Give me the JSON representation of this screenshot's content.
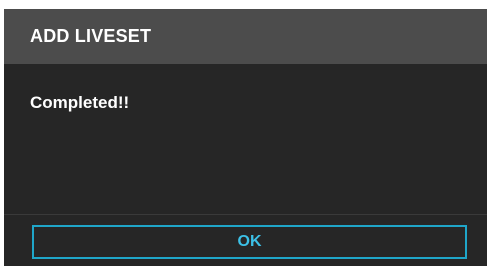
{
  "dialog": {
    "title": "ADD LIVESET",
    "message": "Completed!!",
    "ok_label": "OK"
  },
  "colors": {
    "header_bg": "#4c4c4c",
    "body_bg": "#262626",
    "accent": "#1fa6c9",
    "text": "#ffffff"
  }
}
